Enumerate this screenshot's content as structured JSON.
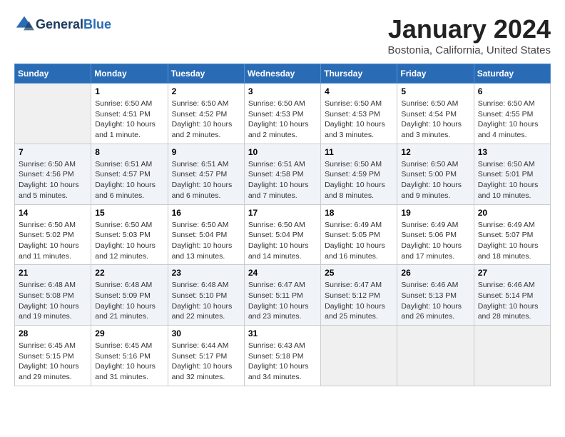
{
  "header": {
    "logo_line1": "General",
    "logo_line2": "Blue",
    "month": "January 2024",
    "location": "Bostonia, California, United States"
  },
  "days_of_week": [
    "Sunday",
    "Monday",
    "Tuesday",
    "Wednesday",
    "Thursday",
    "Friday",
    "Saturday"
  ],
  "weeks": [
    [
      {
        "day": "",
        "info": ""
      },
      {
        "day": "1",
        "info": "Sunrise: 6:50 AM\nSunset: 4:51 PM\nDaylight: 10 hours and 1 minute."
      },
      {
        "day": "2",
        "info": "Sunrise: 6:50 AM\nSunset: 4:52 PM\nDaylight: 10 hours and 2 minutes."
      },
      {
        "day": "3",
        "info": "Sunrise: 6:50 AM\nSunset: 4:53 PM\nDaylight: 10 hours and 2 minutes."
      },
      {
        "day": "4",
        "info": "Sunrise: 6:50 AM\nSunset: 4:53 PM\nDaylight: 10 hours and 3 minutes."
      },
      {
        "day": "5",
        "info": "Sunrise: 6:50 AM\nSunset: 4:54 PM\nDaylight: 10 hours and 3 minutes."
      },
      {
        "day": "6",
        "info": "Sunrise: 6:50 AM\nSunset: 4:55 PM\nDaylight: 10 hours and 4 minutes."
      }
    ],
    [
      {
        "day": "7",
        "info": "Sunrise: 6:50 AM\nSunset: 4:56 PM\nDaylight: 10 hours and 5 minutes."
      },
      {
        "day": "8",
        "info": "Sunrise: 6:51 AM\nSunset: 4:57 PM\nDaylight: 10 hours and 6 minutes."
      },
      {
        "day": "9",
        "info": "Sunrise: 6:51 AM\nSunset: 4:57 PM\nDaylight: 10 hours and 6 minutes."
      },
      {
        "day": "10",
        "info": "Sunrise: 6:51 AM\nSunset: 4:58 PM\nDaylight: 10 hours and 7 minutes."
      },
      {
        "day": "11",
        "info": "Sunrise: 6:50 AM\nSunset: 4:59 PM\nDaylight: 10 hours and 8 minutes."
      },
      {
        "day": "12",
        "info": "Sunrise: 6:50 AM\nSunset: 5:00 PM\nDaylight: 10 hours and 9 minutes."
      },
      {
        "day": "13",
        "info": "Sunrise: 6:50 AM\nSunset: 5:01 PM\nDaylight: 10 hours and 10 minutes."
      }
    ],
    [
      {
        "day": "14",
        "info": "Sunrise: 6:50 AM\nSunset: 5:02 PM\nDaylight: 10 hours and 11 minutes."
      },
      {
        "day": "15",
        "info": "Sunrise: 6:50 AM\nSunset: 5:03 PM\nDaylight: 10 hours and 12 minutes."
      },
      {
        "day": "16",
        "info": "Sunrise: 6:50 AM\nSunset: 5:04 PM\nDaylight: 10 hours and 13 minutes."
      },
      {
        "day": "17",
        "info": "Sunrise: 6:50 AM\nSunset: 5:04 PM\nDaylight: 10 hours and 14 minutes."
      },
      {
        "day": "18",
        "info": "Sunrise: 6:49 AM\nSunset: 5:05 PM\nDaylight: 10 hours and 16 minutes."
      },
      {
        "day": "19",
        "info": "Sunrise: 6:49 AM\nSunset: 5:06 PM\nDaylight: 10 hours and 17 minutes."
      },
      {
        "day": "20",
        "info": "Sunrise: 6:49 AM\nSunset: 5:07 PM\nDaylight: 10 hours and 18 minutes."
      }
    ],
    [
      {
        "day": "21",
        "info": "Sunrise: 6:48 AM\nSunset: 5:08 PM\nDaylight: 10 hours and 19 minutes."
      },
      {
        "day": "22",
        "info": "Sunrise: 6:48 AM\nSunset: 5:09 PM\nDaylight: 10 hours and 21 minutes."
      },
      {
        "day": "23",
        "info": "Sunrise: 6:48 AM\nSunset: 5:10 PM\nDaylight: 10 hours and 22 minutes."
      },
      {
        "day": "24",
        "info": "Sunrise: 6:47 AM\nSunset: 5:11 PM\nDaylight: 10 hours and 23 minutes."
      },
      {
        "day": "25",
        "info": "Sunrise: 6:47 AM\nSunset: 5:12 PM\nDaylight: 10 hours and 25 minutes."
      },
      {
        "day": "26",
        "info": "Sunrise: 6:46 AM\nSunset: 5:13 PM\nDaylight: 10 hours and 26 minutes."
      },
      {
        "day": "27",
        "info": "Sunrise: 6:46 AM\nSunset: 5:14 PM\nDaylight: 10 hours and 28 minutes."
      }
    ],
    [
      {
        "day": "28",
        "info": "Sunrise: 6:45 AM\nSunset: 5:15 PM\nDaylight: 10 hours and 29 minutes."
      },
      {
        "day": "29",
        "info": "Sunrise: 6:45 AM\nSunset: 5:16 PM\nDaylight: 10 hours and 31 minutes."
      },
      {
        "day": "30",
        "info": "Sunrise: 6:44 AM\nSunset: 5:17 PM\nDaylight: 10 hours and 32 minutes."
      },
      {
        "day": "31",
        "info": "Sunrise: 6:43 AM\nSunset: 5:18 PM\nDaylight: 10 hours and 34 minutes."
      },
      {
        "day": "",
        "info": ""
      },
      {
        "day": "",
        "info": ""
      },
      {
        "day": "",
        "info": ""
      }
    ]
  ]
}
